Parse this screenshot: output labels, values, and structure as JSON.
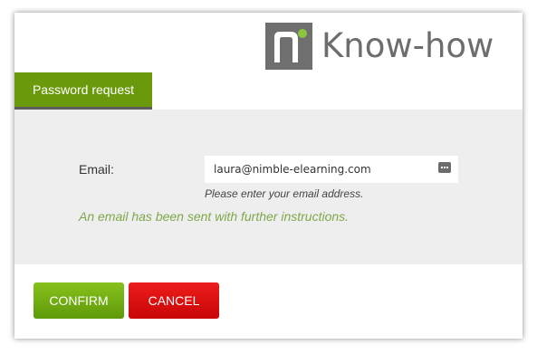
{
  "logo": {
    "brand_text": "Know-how",
    "mark_color": "#6f6f6f",
    "dot_color": "#8cc63f",
    "icon": "know-how-logo-mark"
  },
  "tab": {
    "label": "Password request",
    "color": "#6a9a0c"
  },
  "form": {
    "email_label": "Email:",
    "email_value": "laura@nimble-elearning.com",
    "email_icon": "more-dots-icon",
    "hint": "Please enter your email address.",
    "success_message": "An email has been sent with further instructions."
  },
  "buttons": {
    "confirm_label": "CONFIRM",
    "cancel_label": "CANCEL",
    "confirm_color": "#6fab12",
    "cancel_color": "#e01010"
  }
}
